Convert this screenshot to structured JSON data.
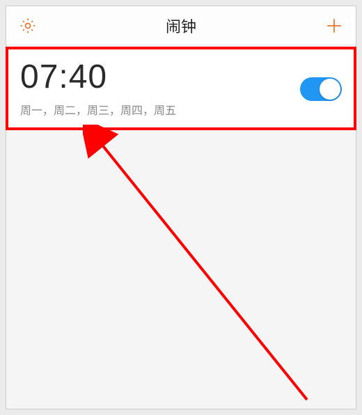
{
  "header": {
    "title": "闹钟"
  },
  "alarm": {
    "time": "07:40",
    "days": "周一，周二，周三，周四，周五",
    "enabled": true
  }
}
